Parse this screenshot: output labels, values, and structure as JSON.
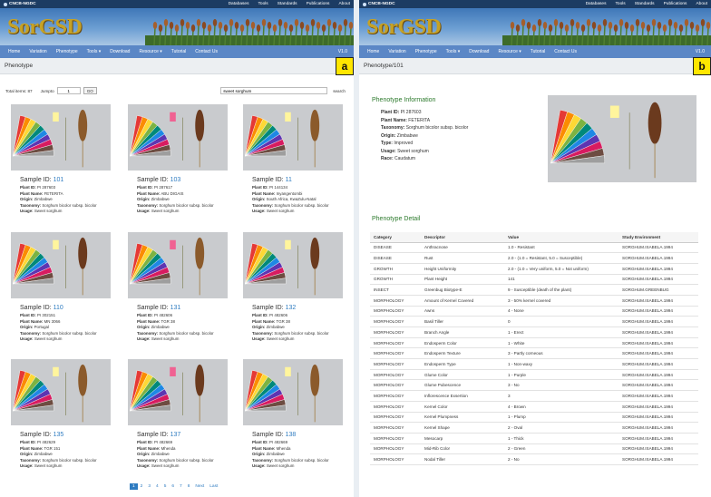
{
  "site": {
    "brand": "CNCB-NGDC",
    "top_links": [
      "Databases",
      "Tools",
      "Standards",
      "Publications",
      "About"
    ],
    "logo_text": "SorGSD",
    "nav": [
      "Home",
      "Variation",
      "Phenotype",
      "Tools ▾",
      "Download",
      "Resource ▾",
      "Tutorial",
      "Contact Us"
    ],
    "version": "V1.0"
  },
  "panel_a": {
    "title": "Phenotype",
    "label": "a",
    "total_items": "Total items: 87",
    "jump_label": "Jumpto",
    "jump_value": "1",
    "go_label": "GO",
    "search_value": "sweet sorghum",
    "search_label": "search",
    "sample_prefix": "Sample ID:",
    "cards": [
      {
        "id": "101",
        "plant_id": "PI 287603",
        "plant_name": "FETERITA",
        "origin": "Zimbabwe",
        "taxonomy": "Sorghum bicolor subsp. bicolor",
        "usage": "Sweet sorghum"
      },
      {
        "id": "103",
        "plant_id": "PI 287617",
        "plant_name": "ABU DIGAIS",
        "origin": "Zimbabwe",
        "taxonomy": "Sorghum bicolor subsp. bicolor",
        "usage": "Sweet sorghum"
      },
      {
        "id": "11",
        "plant_id": "PI 144134",
        "plant_name": "Inyangentombi",
        "origin": "South Africa, KwaZulu-Natal",
        "taxonomy": "Sorghum bicolor subsp. bicolor",
        "usage": "Sweet sorghum"
      },
      {
        "id": "110",
        "plant_id": "PI 302151",
        "plant_name": "MN 3066",
        "origin": "Portugal",
        "taxonomy": "Sorghum bicolor subsp. bicolor",
        "usage": "Sweet sorghum"
      },
      {
        "id": "131",
        "plant_id": "PI 482606",
        "plant_name": "TGR 38",
        "origin": "Zimbabwe",
        "taxonomy": "Sorghum bicolor subsp. bicolor",
        "usage": "Sweet sorghum"
      },
      {
        "id": "132",
        "plant_id": "PI 482606",
        "plant_name": "TGR 38",
        "origin": "Zimbabwe",
        "taxonomy": "Sorghum bicolor subsp. bicolor",
        "usage": "Sweet sorghum"
      },
      {
        "id": "135",
        "plant_id": "PI 482629",
        "plant_name": "TGR 151",
        "origin": "Zimbabwe",
        "taxonomy": "Sorghum bicolor subsp. bicolor",
        "usage": "Sweet sorghum"
      },
      {
        "id": "137",
        "plant_id": "PI 482669",
        "plant_name": "Mhenda",
        "origin": "Zimbabwe",
        "taxonomy": "Sorghum bicolor subsp. bicolor",
        "usage": "Sweet sorghum"
      },
      {
        "id": "138",
        "plant_id": "PI 482669",
        "plant_name": "Mhenda",
        "origin": "Zimbabwe",
        "taxonomy": "Sorghum bicolor subsp. bicolor",
        "usage": "Sweet sorghum"
      }
    ],
    "field_labels": {
      "plant_id": "Plant ID:",
      "plant_name": "Plant Name:",
      "origin": "Origin:",
      "taxonomy": "Taxonomy:",
      "usage": "Usage:"
    },
    "pager": [
      "1",
      "2",
      "3",
      "4",
      "5",
      "6",
      "7",
      "8",
      "Next",
      "Last"
    ]
  },
  "panel_b": {
    "title": "Phenotype/101",
    "label": "b",
    "info_heading": "Phenotype Information",
    "info": [
      {
        "label": "Plant ID:",
        "value": "PI 287603"
      },
      {
        "label": "Plant Name:",
        "value": "FETERITA"
      },
      {
        "label": "Taxonomy:",
        "value": "Sorghum bicolor subsp. bicolor"
      },
      {
        "label": "Origin:",
        "value": "Zimbabwe"
      },
      {
        "label": "Type:",
        "value": "Improved"
      },
      {
        "label": "Usage:",
        "value": "Sweet sorghum"
      },
      {
        "label": "Race:",
        "value": "Caudatum"
      }
    ],
    "detail_heading": "Phenotype Detail",
    "columns": [
      "Category",
      "Descriptor",
      "Value",
      "Study Environment"
    ],
    "rows": [
      [
        "DISEASE",
        "Anthracnose",
        "1.0 - Resistant",
        "SORGHUM.ISABELA.1994"
      ],
      [
        "DISEASE",
        "Rust",
        "2.0 - (1.0 = Resistant, 5.0 = Susceptible)",
        "SORGHUM.ISABELA.1994"
      ],
      [
        "GROWTH",
        "Height Uniformity",
        "2.0 - (1.0 = Very uniform, 5.0 = Not uniform)",
        "SORGHUM.ISABELA.1994"
      ],
      [
        "GROWTH",
        "Plant Height",
        "141",
        "SORGHUM.ISABELA.1994"
      ],
      [
        "INSECT",
        "Greenbug Biotype-E",
        "9 - Susceptible (death of the plant)",
        "SORGHUM.GREENBUG"
      ],
      [
        "MORPHOLOGY",
        "Amount of Kernel Covered",
        "3 - 50% kernel covered",
        "SORGHUM.ISABELA.1994"
      ],
      [
        "MORPHOLOGY",
        "Awns",
        "4 - None",
        "SORGHUM.ISABELA.1994"
      ],
      [
        "MORPHOLOGY",
        "Basil Tiller",
        "0",
        "SORGHUM.ISABELA.1994"
      ],
      [
        "MORPHOLOGY",
        "Branch Angle",
        "1 - Erect",
        "SORGHUM.ISABELA.1994"
      ],
      [
        "MORPHOLOGY",
        "Endosperm Color",
        "1 - White",
        "SORGHUM.ISABELA.1994"
      ],
      [
        "MORPHOLOGY",
        "Endosperm Texture",
        "3 - Partly corneous",
        "SORGHUM.ISABELA.1994"
      ],
      [
        "MORPHOLOGY",
        "Endosperm Type",
        "1 - Non-waxy",
        "SORGHUM.ISABELA.1994"
      ],
      [
        "MORPHOLOGY",
        "Glume Color",
        "1 - Purple",
        "SORGHUM.ISABELA.1994"
      ],
      [
        "MORPHOLOGY",
        "Glume Pubescence",
        "3 - No",
        "SORGHUM.ISABELA.1994"
      ],
      [
        "MORPHOLOGY",
        "Inflorescence Exsertion",
        "3",
        "SORGHUM.ISABELA.1994"
      ],
      [
        "MORPHOLOGY",
        "Kernel Color",
        "4 - Brown",
        "SORGHUM.ISABELA.1994"
      ],
      [
        "MORPHOLOGY",
        "Kernel Plumpness",
        "1 - Plump",
        "SORGHUM.ISABELA.1994"
      ],
      [
        "MORPHOLOGY",
        "Kernel Shape",
        "2 - Oval",
        "SORGHUM.ISABELA.1994"
      ],
      [
        "MORPHOLOGY",
        "Mesocarp",
        "1 - Thick",
        "SORGHUM.ISABELA.1994"
      ],
      [
        "MORPHOLOGY",
        "Mid-Rib Color",
        "2 - Green",
        "SORGHUM.ISABELA.1994"
      ],
      [
        "MORPHOLOGY",
        "Nodal Tiller",
        "2 - No",
        "SORGHUM.ISABELA.1994"
      ]
    ]
  }
}
